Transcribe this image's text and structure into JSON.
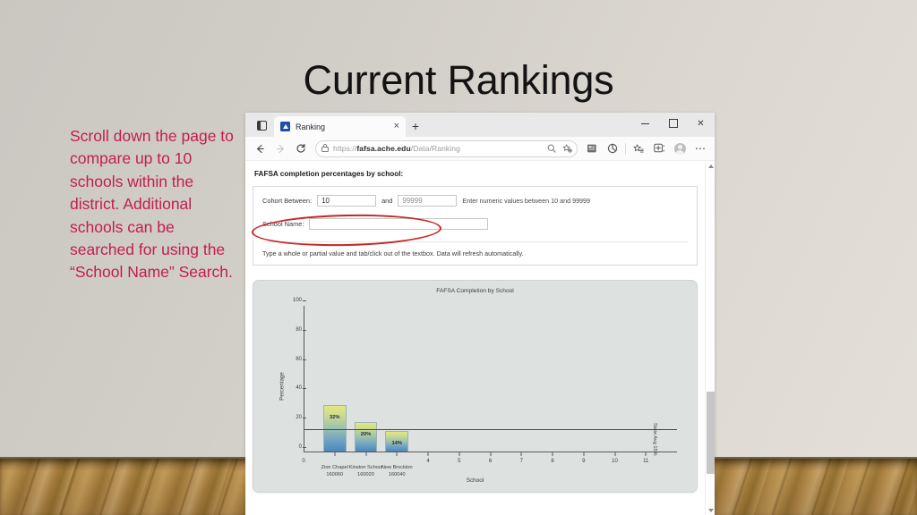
{
  "slide": {
    "title": "Current Rankings",
    "body_text": "Scroll down the page to compare up to 10 schools within the district. Additional schools can be searched for using the “School Name” Search.",
    "accent_color": "#c41e4b",
    "annotation_color": "#c62626"
  },
  "browser": {
    "tab_title": "Ranking",
    "new_tab_label": "+",
    "close_tab_label": "×",
    "window_controls": {
      "minimize": "–",
      "maximize": "□",
      "close": "✕"
    },
    "address": {
      "scheme": "https://",
      "host": "fafsa.ache.edu",
      "path": "/Data/Ranking",
      "full_url": "https://fafsa.ache.edu/Data/Ranking"
    },
    "nav": {
      "back": "←",
      "forward": "→",
      "refresh": "↻"
    },
    "overflow_label": "⋯"
  },
  "page": {
    "heading": "FAFSA completion percentages by school:",
    "cohort_label": "Cohort Between:",
    "cohort_min": "10",
    "cohort_max": "99999",
    "and_label": "and",
    "cohort_hint": "Enter numeric values between 10 and 99999",
    "school_name_label": "School Name:",
    "school_name_value": "",
    "school_name_placeholder": "",
    "footnote": "Type a whole or partial value and tab/click out of the textbox. Data will refresh automatically."
  },
  "chart_data": {
    "type": "bar",
    "title": "FAFSA Completion by School",
    "xlabel": "School",
    "ylabel": "Percentage",
    "ylim": [
      0,
      100
    ],
    "yticks": [
      0,
      20,
      40,
      60,
      80,
      100
    ],
    "xticks": [
      "0",
      "4",
      "5",
      "6",
      "7",
      "8",
      "9",
      "10",
      "11"
    ],
    "grid": false,
    "legend": "none",
    "categories": [
      {
        "name": "Zion Chapel",
        "code": "160060"
      },
      {
        "name": "Kinston School",
        "code": "160020"
      },
      {
        "name": "New Brockton",
        "code": "160040"
      }
    ],
    "values": [
      32,
      20,
      14
    ],
    "value_labels": [
      "32%",
      "20%",
      "14%"
    ],
    "reference_line": {
      "label": "State Avg 15%",
      "value": 15
    },
    "bar_gradient": [
      "#e3e682",
      "#4b86bc"
    ],
    "plot_background": "#dde1e0"
  }
}
